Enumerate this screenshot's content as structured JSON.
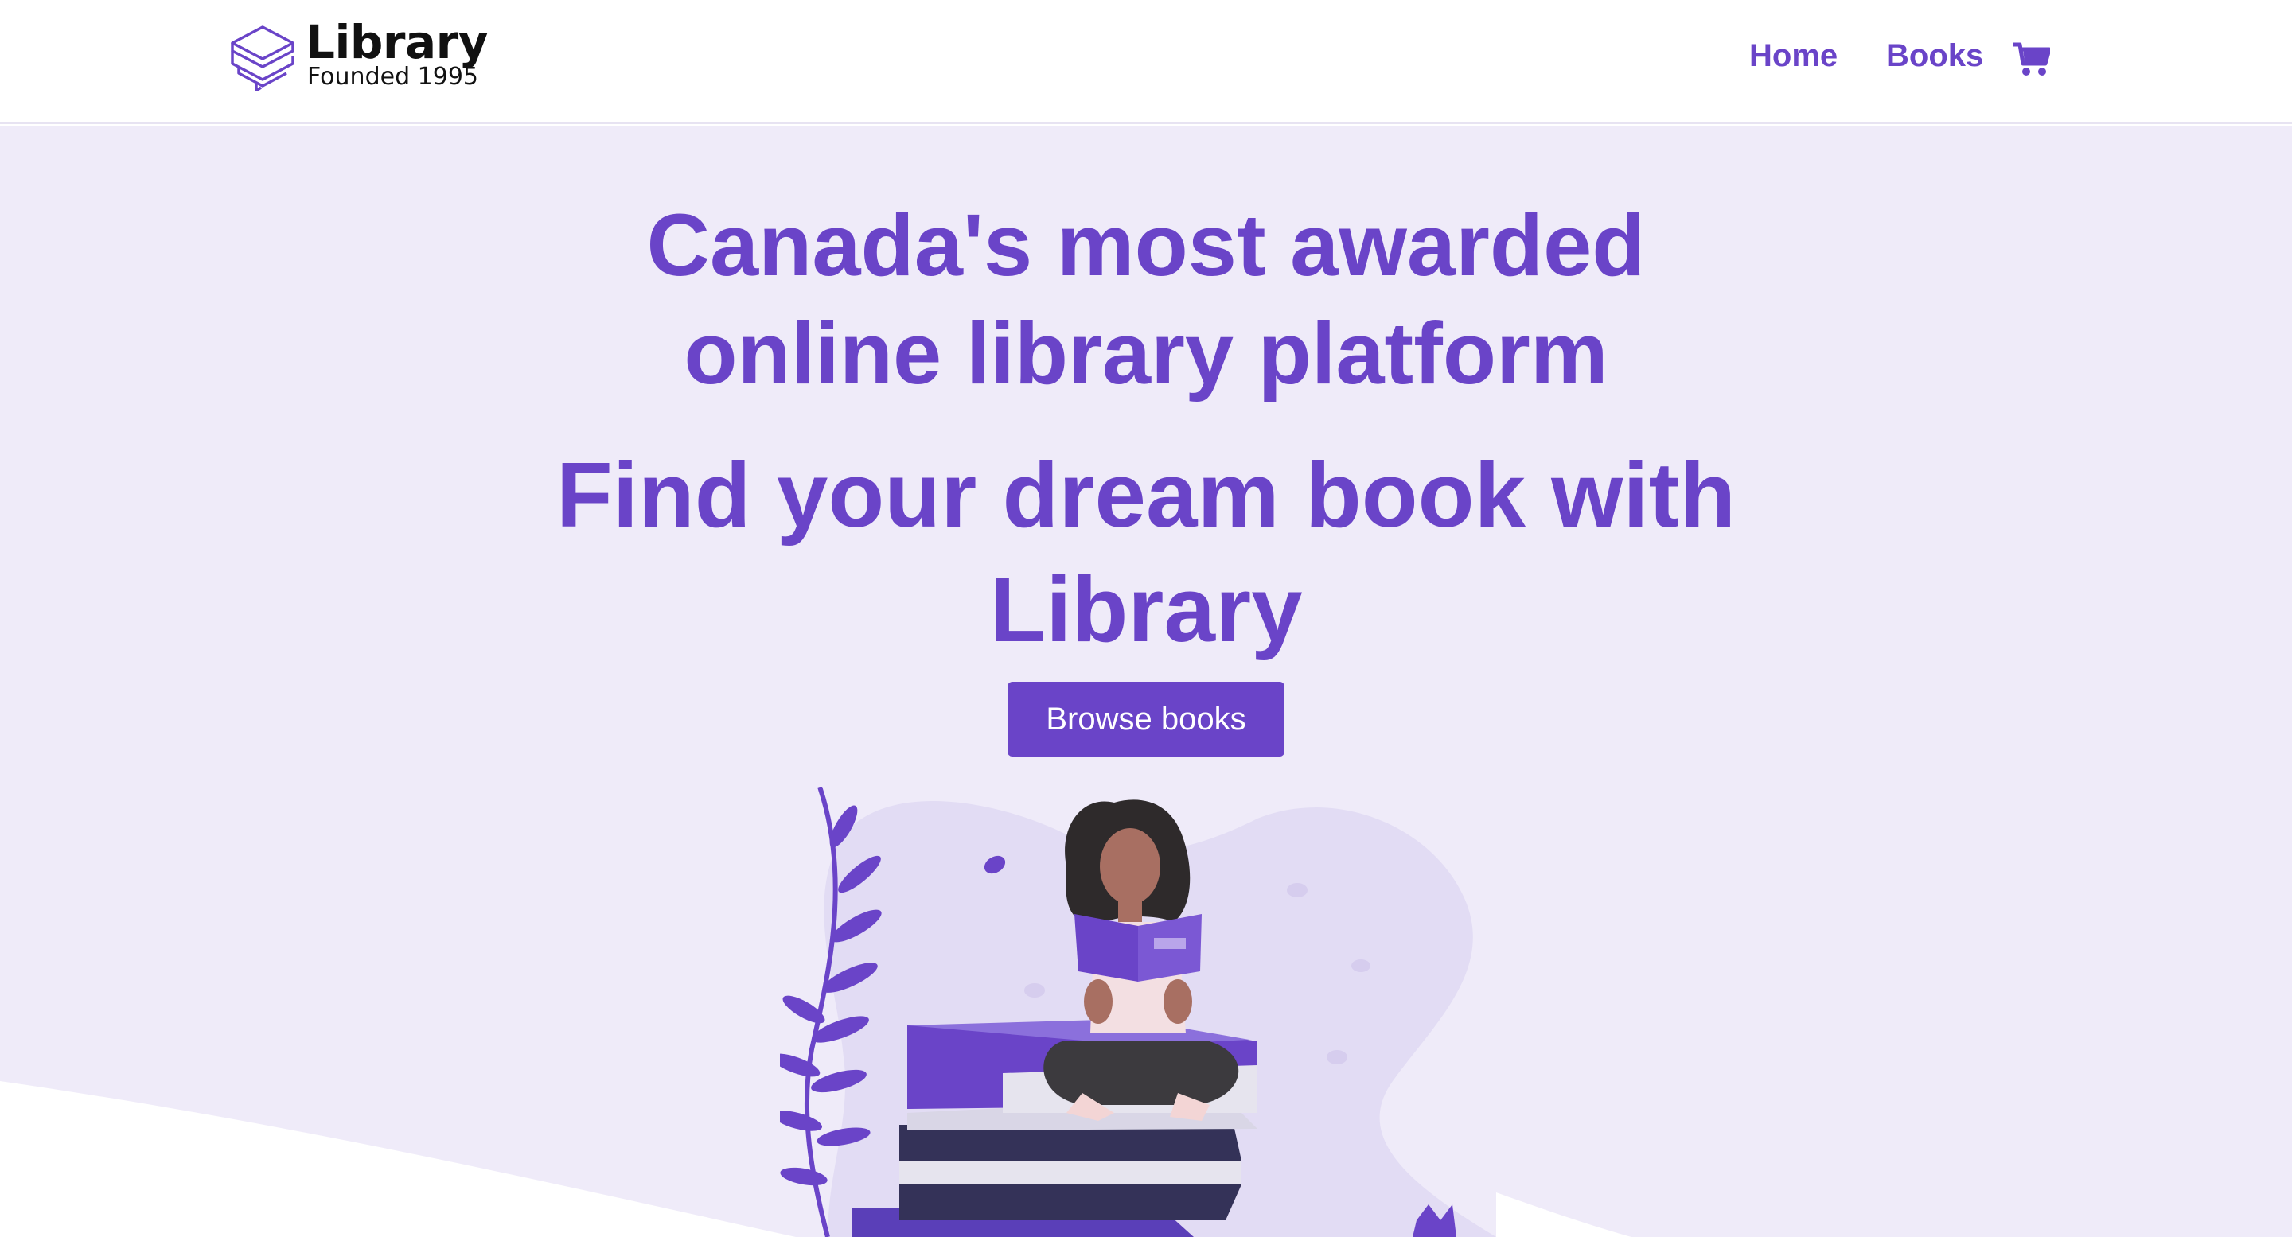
{
  "header": {
    "logo_title": "Library",
    "logo_subtitle": "Founded 1995",
    "logo_icon": "stacked-books-icon",
    "nav": [
      {
        "label": "Home"
      },
      {
        "label": "Books"
      }
    ],
    "cart_icon": "shopping-cart-icon"
  },
  "hero": {
    "headline": "Canada's most awarded online library platform",
    "subheadline": "Find your dream book with Library",
    "cta_label": "Browse books",
    "illustration": "woman-reading-on-book-stack"
  },
  "colors": {
    "brand": "#6a44c8",
    "hero_background": "#efebf9",
    "blob": "#e2dcf4",
    "text_dark": "#111111"
  }
}
